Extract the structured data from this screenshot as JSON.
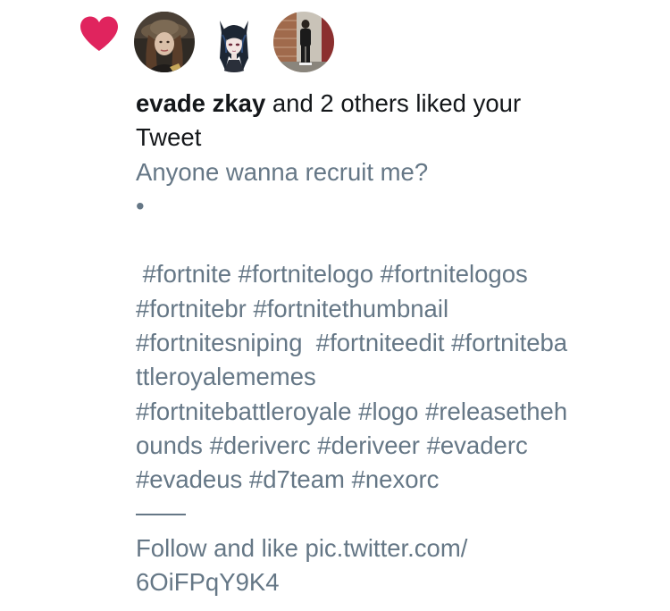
{
  "notification": {
    "actor_name": "evade zkay",
    "action_text": " and 2 others liked your",
    "action_text_2": "Tweet",
    "icon": "heart-icon",
    "avatars": [
      "avatar-evade-zkay",
      "avatar-cat-ear-anime",
      "avatar-person-standing"
    ]
  },
  "tweet": {
    "lines": [
      "Anyone wanna recruit me?",
      "•",
      "",
      " #fortnite #fortnitelogo #fortnitelogos",
      "#fortnitebr #fortnitethumbnail",
      "#fortnitesniping  #fortniteedit #fortniteba",
      "ttleroyalememes",
      "#fortnitebattleroyale #logo #releasetheh",
      "ounds #deriverc #deriveer #evaderc",
      "#evadeus #d7team #nexorc"
    ],
    "footer_lines": [
      "Follow and like pic.twitter.com/",
      "6OiFPqY9K4"
    ]
  },
  "colors": {
    "like": "#e0245e",
    "primary_text": "#14171a",
    "secondary_text": "#657786"
  }
}
